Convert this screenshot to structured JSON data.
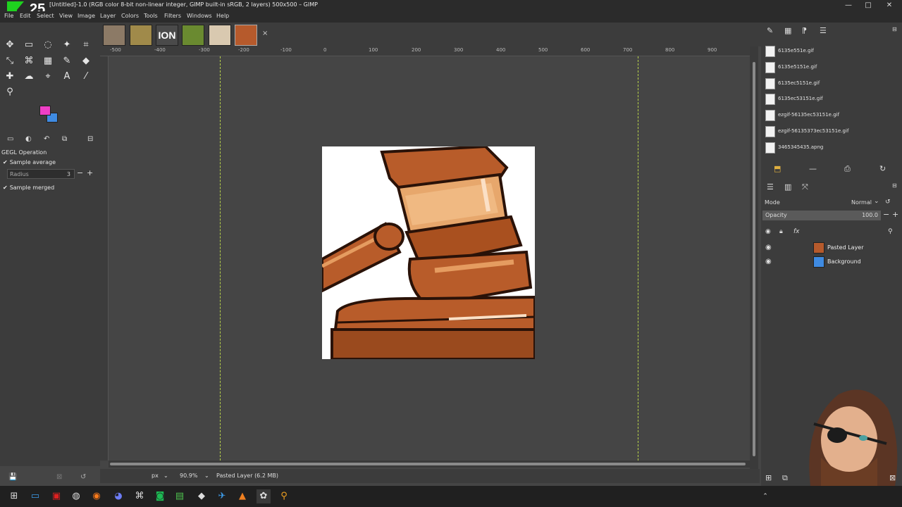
{
  "window": {
    "title": "[Untitled]-1.0 (RGB color 8-bit non-linear integer, GIMP built-in sRGB, 2 layers) 500x500 – GIMP",
    "controls": [
      "minimize-icon",
      "maximize-icon",
      "close-icon"
    ]
  },
  "channel_logo": "25",
  "menu": [
    "File",
    "Edit",
    "Select",
    "View",
    "Image",
    "Layer",
    "Colors",
    "Tools",
    "Filters",
    "Windows",
    "Help"
  ],
  "image_tabs": {
    "items": [
      "gavel-thumb",
      "scales-thumb",
      "ion-thumb",
      "snake-thumb",
      "character-thumb",
      "gavel-active-thumb"
    ],
    "ion_label": "ION",
    "close": "×"
  },
  "toolbox": {
    "tools": [
      "move-icon",
      "rect-select-icon",
      "lasso-icon",
      "fuzzy-select-icon",
      "crop-icon",
      "transform-icon",
      "warp-icon",
      "cage-icon",
      "gradient-icon",
      "paintbrush-icon",
      "eraser-icon",
      "heal-icon",
      "smudge-icon",
      "path-icon",
      "text-icon",
      "color-picker-icon",
      "zoom-icon"
    ],
    "fg_color": "#ee3fc6",
    "bg_color": "#3f8be2"
  },
  "tool_options": {
    "title": "GEGL Operation",
    "sample_average_label": "Sample average",
    "sample_average": true,
    "radius_label": "Radius",
    "radius_value": "3",
    "sample_merged_label": "Sample merged",
    "sample_merged": true
  },
  "rulers": {
    "h_ticks": [
      "-500",
      "-400",
      "-300",
      "-200",
      "-100",
      "0",
      "100",
      "200",
      "300",
      "400",
      "500",
      "600",
      "700",
      "800",
      "900"
    ]
  },
  "statusbar": {
    "unit": "px",
    "zoom": "90.9%",
    "info": "Pasted Layer (6.2 MB)"
  },
  "files": [
    "6135e551e.gif",
    "6135e5151e.gif",
    "6135ec5151e.gif",
    "6135ec53151e.gif",
    "ezgif-56135ec53151e.gif",
    "ezgif-56135373ec53151e.gif",
    "3465345435.apng"
  ],
  "layers_panel": {
    "mode_label": "Mode",
    "mode_value": "Normal",
    "opacity_label": "Opacity",
    "opacity_value": "100.0",
    "layers": [
      {
        "name": "Pasted Layer",
        "visible": true
      },
      {
        "name": "Background",
        "visible": true
      }
    ]
  },
  "taskbar": {
    "apps": [
      "start-icon",
      "file-explorer-icon",
      "store-icon",
      "steam-icon",
      "firefox-icon",
      "discord-icon",
      "gamepad-icon",
      "spotify-icon",
      "notepad-icon",
      "app-icon",
      "steam2-icon",
      "vlc-icon",
      "gimp-icon",
      "search-icon"
    ]
  }
}
